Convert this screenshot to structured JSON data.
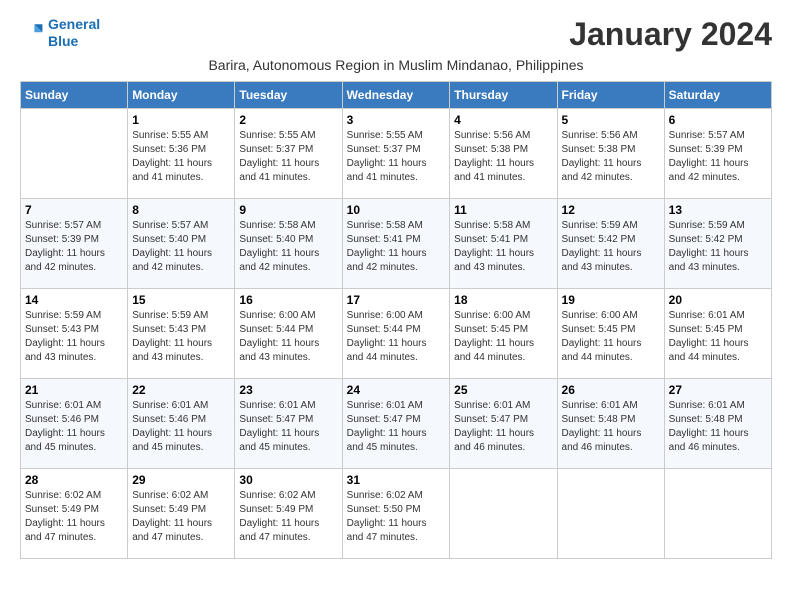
{
  "logo": {
    "line1": "General",
    "line2": "Blue"
  },
  "month_title": "January 2024",
  "subtitle": "Barira, Autonomous Region in Muslim Mindanao, Philippines",
  "days_of_week": [
    "Sunday",
    "Monday",
    "Tuesday",
    "Wednesday",
    "Thursday",
    "Friday",
    "Saturday"
  ],
  "weeks": [
    [
      {
        "day": "",
        "info": ""
      },
      {
        "day": "1",
        "info": "Sunrise: 5:55 AM\nSunset: 5:36 PM\nDaylight: 11 hours\nand 41 minutes."
      },
      {
        "day": "2",
        "info": "Sunrise: 5:55 AM\nSunset: 5:37 PM\nDaylight: 11 hours\nand 41 minutes."
      },
      {
        "day": "3",
        "info": "Sunrise: 5:55 AM\nSunset: 5:37 PM\nDaylight: 11 hours\nand 41 minutes."
      },
      {
        "day": "4",
        "info": "Sunrise: 5:56 AM\nSunset: 5:38 PM\nDaylight: 11 hours\nand 41 minutes."
      },
      {
        "day": "5",
        "info": "Sunrise: 5:56 AM\nSunset: 5:38 PM\nDaylight: 11 hours\nand 42 minutes."
      },
      {
        "day": "6",
        "info": "Sunrise: 5:57 AM\nSunset: 5:39 PM\nDaylight: 11 hours\nand 42 minutes."
      }
    ],
    [
      {
        "day": "7",
        "info": "Sunrise: 5:57 AM\nSunset: 5:39 PM\nDaylight: 11 hours\nand 42 minutes."
      },
      {
        "day": "8",
        "info": "Sunrise: 5:57 AM\nSunset: 5:40 PM\nDaylight: 11 hours\nand 42 minutes."
      },
      {
        "day": "9",
        "info": "Sunrise: 5:58 AM\nSunset: 5:40 PM\nDaylight: 11 hours\nand 42 minutes."
      },
      {
        "day": "10",
        "info": "Sunrise: 5:58 AM\nSunset: 5:41 PM\nDaylight: 11 hours\nand 42 minutes."
      },
      {
        "day": "11",
        "info": "Sunrise: 5:58 AM\nSunset: 5:41 PM\nDaylight: 11 hours\nand 43 minutes."
      },
      {
        "day": "12",
        "info": "Sunrise: 5:59 AM\nSunset: 5:42 PM\nDaylight: 11 hours\nand 43 minutes."
      },
      {
        "day": "13",
        "info": "Sunrise: 5:59 AM\nSunset: 5:42 PM\nDaylight: 11 hours\nand 43 minutes."
      }
    ],
    [
      {
        "day": "14",
        "info": "Sunrise: 5:59 AM\nSunset: 5:43 PM\nDaylight: 11 hours\nand 43 minutes."
      },
      {
        "day": "15",
        "info": "Sunrise: 5:59 AM\nSunset: 5:43 PM\nDaylight: 11 hours\nand 43 minutes."
      },
      {
        "day": "16",
        "info": "Sunrise: 6:00 AM\nSunset: 5:44 PM\nDaylight: 11 hours\nand 43 minutes."
      },
      {
        "day": "17",
        "info": "Sunrise: 6:00 AM\nSunset: 5:44 PM\nDaylight: 11 hours\nand 44 minutes."
      },
      {
        "day": "18",
        "info": "Sunrise: 6:00 AM\nSunset: 5:45 PM\nDaylight: 11 hours\nand 44 minutes."
      },
      {
        "day": "19",
        "info": "Sunrise: 6:00 AM\nSunset: 5:45 PM\nDaylight: 11 hours\nand 44 minutes."
      },
      {
        "day": "20",
        "info": "Sunrise: 6:01 AM\nSunset: 5:45 PM\nDaylight: 11 hours\nand 44 minutes."
      }
    ],
    [
      {
        "day": "21",
        "info": "Sunrise: 6:01 AM\nSunset: 5:46 PM\nDaylight: 11 hours\nand 45 minutes."
      },
      {
        "day": "22",
        "info": "Sunrise: 6:01 AM\nSunset: 5:46 PM\nDaylight: 11 hours\nand 45 minutes."
      },
      {
        "day": "23",
        "info": "Sunrise: 6:01 AM\nSunset: 5:47 PM\nDaylight: 11 hours\nand 45 minutes."
      },
      {
        "day": "24",
        "info": "Sunrise: 6:01 AM\nSunset: 5:47 PM\nDaylight: 11 hours\nand 45 minutes."
      },
      {
        "day": "25",
        "info": "Sunrise: 6:01 AM\nSunset: 5:47 PM\nDaylight: 11 hours\nand 46 minutes."
      },
      {
        "day": "26",
        "info": "Sunrise: 6:01 AM\nSunset: 5:48 PM\nDaylight: 11 hours\nand 46 minutes."
      },
      {
        "day": "27",
        "info": "Sunrise: 6:01 AM\nSunset: 5:48 PM\nDaylight: 11 hours\nand 46 minutes."
      }
    ],
    [
      {
        "day": "28",
        "info": "Sunrise: 6:02 AM\nSunset: 5:49 PM\nDaylight: 11 hours\nand 47 minutes."
      },
      {
        "day": "29",
        "info": "Sunrise: 6:02 AM\nSunset: 5:49 PM\nDaylight: 11 hours\nand 47 minutes."
      },
      {
        "day": "30",
        "info": "Sunrise: 6:02 AM\nSunset: 5:49 PM\nDaylight: 11 hours\nand 47 minutes."
      },
      {
        "day": "31",
        "info": "Sunrise: 6:02 AM\nSunset: 5:50 PM\nDaylight: 11 hours\nand 47 minutes."
      },
      {
        "day": "",
        "info": ""
      },
      {
        "day": "",
        "info": ""
      },
      {
        "day": "",
        "info": ""
      }
    ]
  ]
}
